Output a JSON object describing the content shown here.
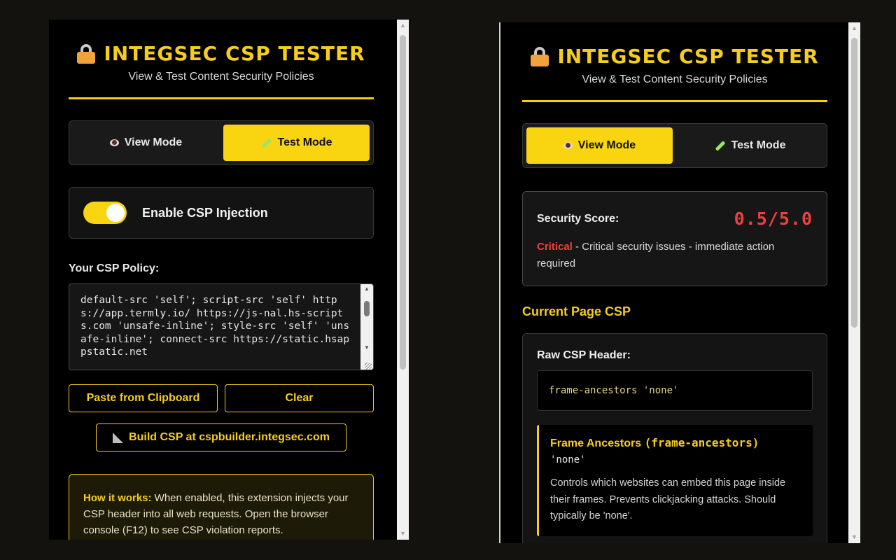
{
  "header": {
    "title": "INTEGSEC CSP TESTER",
    "subtitle": "View & Test Content Security Policies"
  },
  "modes": {
    "view_label": "View Mode",
    "test_label": "Test Mode"
  },
  "left": {
    "active_mode": "test",
    "inject_label": "Enable CSP Injection",
    "inject_enabled": true,
    "policy_label": "Your CSP Policy:",
    "policy_text": "default-src 'self'; script-src 'self' https://app.termly.io/ https://js-nal.hs-scripts.com 'unsafe-inline'; style-src 'self' 'unsafe-inline'; connect-src https://static.hsappstatic.net",
    "paste_label": "Paste from Clipboard",
    "clear_label": "Clear",
    "build_label": "Build CSP at cspbuilder.integsec.com",
    "how_title": "How it works:",
    "how_text": " When enabled, this extension injects your CSP header into all web requests. Open the browser console (F12) to see CSP violation reports."
  },
  "right": {
    "active_mode": "view",
    "score_label": "Security Score:",
    "score_value": "0.5/5.0",
    "severity": "Critical",
    "severity_text": " - Critical security issues - immediate action required",
    "current_label": "Current Page CSP",
    "raw_label": "Raw CSP Header:",
    "raw_value": "frame-ancestors 'none'",
    "directive_name": "Frame Ancestors",
    "directive_key": "(frame-ancestors)",
    "directive_value": "'none'",
    "directive_desc": "Controls which websites can embed this page inside their frames. Prevents clickjacking attacks. Should typically be 'none'."
  },
  "colors": {
    "accent": "#f5cd1d",
    "critical": "#ef4040",
    "background": "#000000"
  },
  "icons": [
    "lock-icon",
    "eye-icon",
    "test-tube-icon",
    "ruler-icon"
  ]
}
